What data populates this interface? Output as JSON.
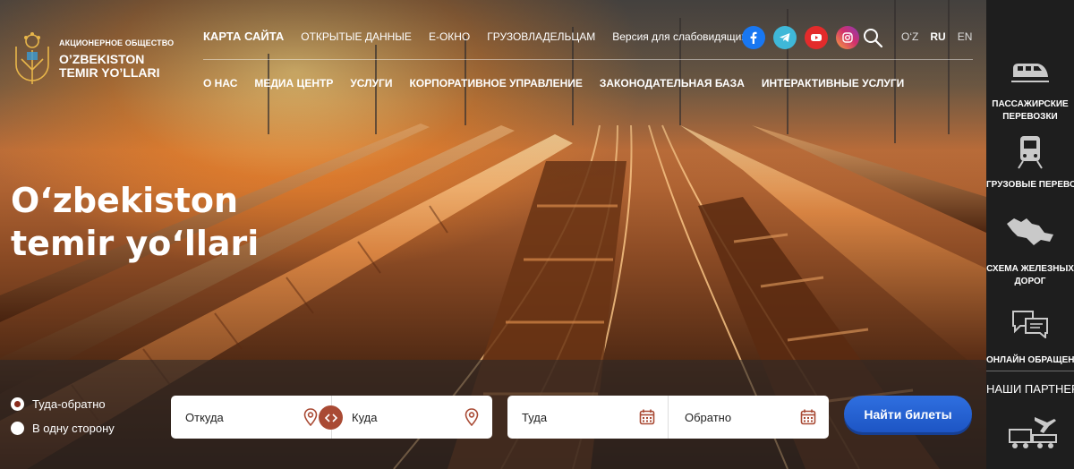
{
  "brand": {
    "small": "АКЦИОНЕРНОЕ ОБЩЕСТВО",
    "line1": "O’ZBEKISTON",
    "line2": "TEMIR YO’LLARI"
  },
  "topnav": [
    {
      "label": "КАРТА САЙТА"
    },
    {
      "label": "ОТКРЫТЫЕ ДАННЫЕ"
    },
    {
      "label": "E-ОКНО"
    },
    {
      "label": "ГРУЗОВЛАДЕЛЬЦАМ"
    },
    {
      "label": "Версия для слабовидящих"
    }
  ],
  "socials": [
    {
      "name": "facebook-icon",
      "color": "#1877f2"
    },
    {
      "name": "telegram-icon",
      "color": "#3fb8d8"
    },
    {
      "name": "youtube-icon",
      "color": "#e32b2b"
    },
    {
      "name": "instagram-icon",
      "color": "#d1306c"
    }
  ],
  "languages": [
    {
      "label": "O‘Z",
      "active": false
    },
    {
      "label": "RU",
      "active": true
    },
    {
      "label": "EN",
      "active": false
    }
  ],
  "mainnav": [
    {
      "label": "О НАС"
    },
    {
      "label": "МЕДИА ЦЕНТР"
    },
    {
      "label": "УСЛУГИ"
    },
    {
      "label": "КОРПОРАТИВНОЕ УПРАВЛЕНИЕ"
    },
    {
      "label": "ЗАКОНОДАТЕЛЬНАЯ БАЗА"
    },
    {
      "label": "ИНТЕРАКТИВНЫЕ УСЛУГИ"
    }
  ],
  "hero": {
    "line1": "O‘zbekiston",
    "line2": "temir yo‘llari"
  },
  "booking": {
    "trip_roundtrip": "Туда-обратно",
    "trip_oneway": "В одну сторону",
    "selected_trip": "roundtrip",
    "from_placeholder": "Откуда",
    "to_placeholder": "Куда",
    "depart_placeholder": "Туда",
    "return_placeholder": "Обратно",
    "search_button": "Найти билеты",
    "accent": "#a94a34",
    "button_color": "#2f6fe0"
  },
  "sidebar": {
    "items": [
      {
        "label": "ПАССАЖИРСКИЕ ПЕРЕВОЗКИ",
        "icon": "passenger-train-icon"
      },
      {
        "label": "ГРУЗОВЫЕ ПЕРЕВОЗКИ",
        "icon": "freight-train-icon"
      },
      {
        "label": "СХЕМА ЖЕЛЕЗНЫХ ДОРОГ",
        "icon": "map-icon"
      },
      {
        "label": "ОНЛАЙН ОБРАЩЕНИЯ",
        "icon": "chat-icon"
      }
    ],
    "partners": "НАШИ ПАРТНЕРЫ"
  }
}
